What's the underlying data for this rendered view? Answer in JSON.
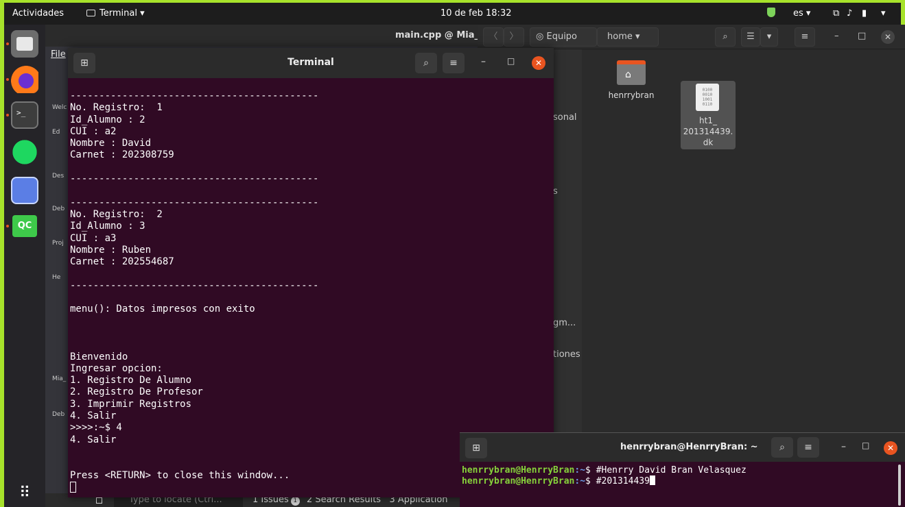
{
  "topbar": {
    "activities": "Actividades",
    "app_menu": "Terminal ▾",
    "clock": "10 de feb  18:32",
    "lang": "es ▾",
    "net_icon": "network-icon",
    "volume_icon": "volume-icon",
    "battery_icon": "battery-icon",
    "power": "▾"
  },
  "accent_color": "#a7e22b",
  "dock": {
    "terminal_glyph": ">_",
    "qc_label": "QC",
    "apps_glyph": "⠿"
  },
  "qt": {
    "title": "main.cpp @ Mia_",
    "menu_file": "File",
    "side": [
      "Welc",
      "Ed",
      "Des",
      "Deb",
      "Proj",
      "He",
      "Mia_",
      "Deb"
    ],
    "locate_placeholder": "Type to locate (Ctrl...",
    "issues": "1  Issues",
    "issues_count": "1",
    "search_results": "2  Search Results",
    "application": "3  Application"
  },
  "files": {
    "back": "〈",
    "forward": "〉",
    "location_equipo": "Equipo",
    "location_home": "home  ▾",
    "search_icon": "⌕",
    "sidebar": [
      "sonal",
      "s",
      "gm...",
      "tiones"
    ],
    "items": [
      {
        "name": "henrrybran",
        "type": "folder"
      },
      {
        "name": "ht1_\n201314439.\ndk",
        "type": "file"
      }
    ],
    "file_icon_text": "0100\n0010\n1001\n0110"
  },
  "terminal": {
    "title": "Terminal",
    "output": "-------------------------------------------\nNo. Registro:  1\nId_Alumno : 2\nCUI : a2\nNombre : David\nCarnet : 202308759\n\n-------------------------------------------\n\n-------------------------------------------\nNo. Registro:  2\nId_Alumno : 3\nCUI : a3\nNombre : Ruben\nCarnet : 202554687\n\n-------------------------------------------\n\nmenu(): Datos impresos con exito\n\n\n\nBienvenido\nIngresar opcion:\n1. Registro De Alumno\n2. Registro De Profesor\n3. Imprimir Registros\n4. Salir\n>>>>:~$ 4\n4. Salir\n\n\nPress <RETURN> to close this window...\n"
  },
  "terminal2": {
    "title": "henrrybran@HenrryBran: ~",
    "lines": [
      {
        "user": "henrrybran@HenrryBran",
        "path": ":~",
        "prompt": "$ ",
        "cmd": "#Henrry David Bran Velasquez"
      },
      {
        "user": "henrrybran@HenrryBran",
        "path": ":~",
        "prompt": "$ ",
        "cmd": "#201314439"
      }
    ]
  }
}
